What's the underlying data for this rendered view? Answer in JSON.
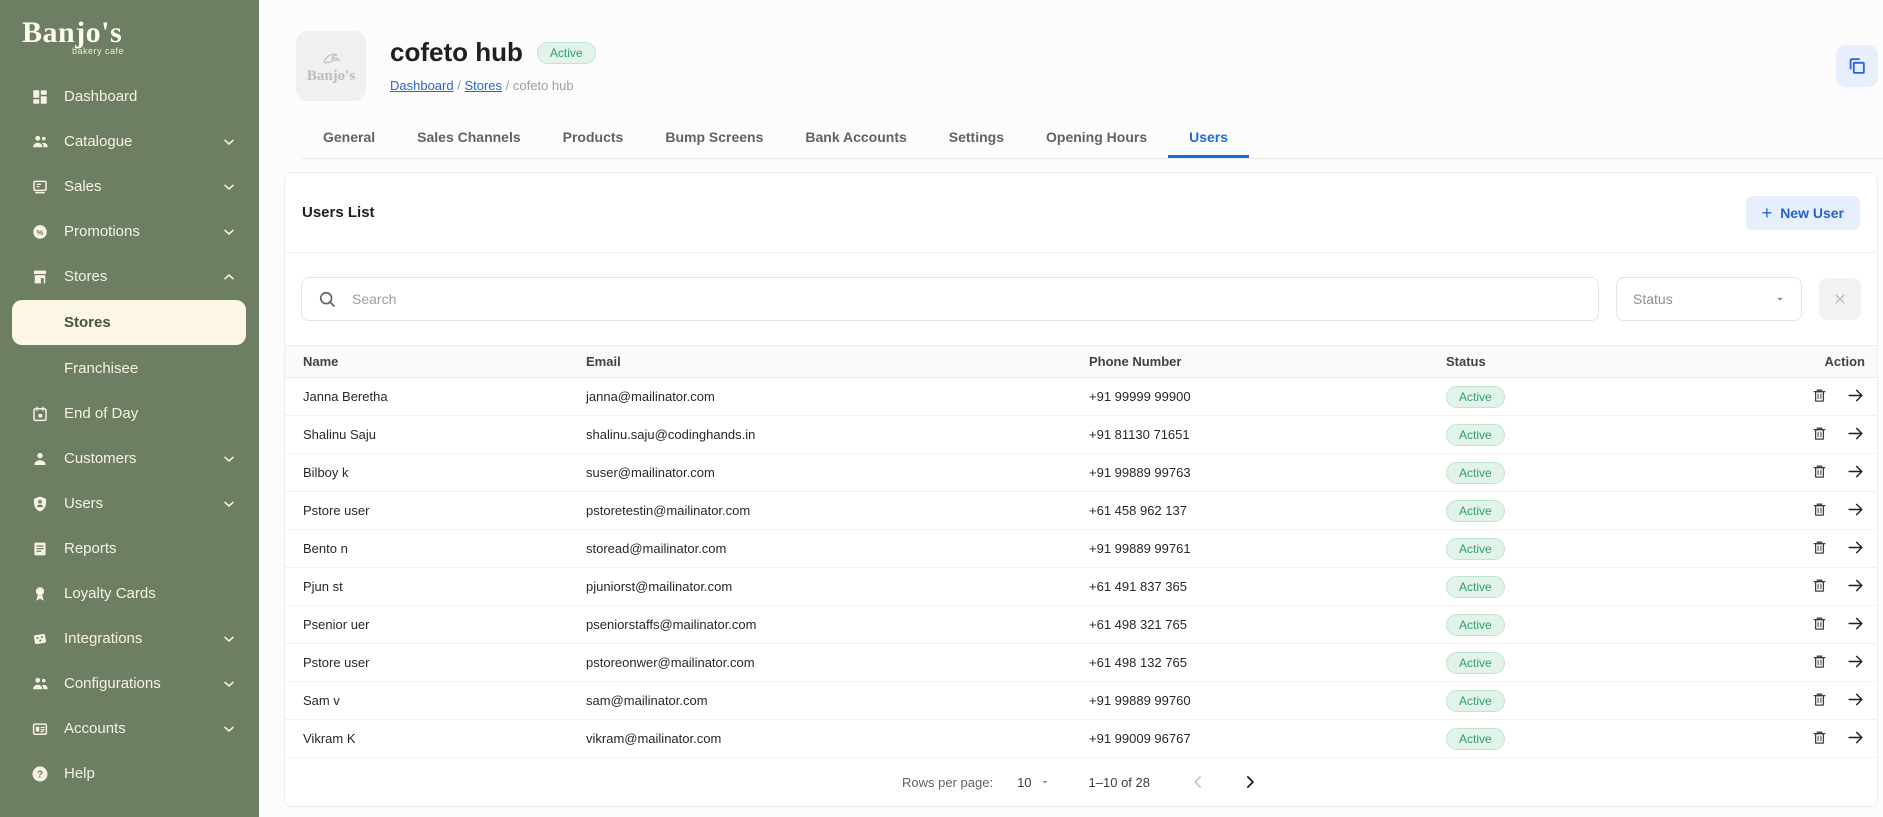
{
  "brand": {
    "name": "Banjo's",
    "tagline": "bakery cafe"
  },
  "colors": {
    "sidebar_green": "#6e7e63",
    "sidebar_active_cream": "#fcf7e5",
    "accent_blue": "#1a6fd4",
    "link_blue": "#2b66c4",
    "status_green_text": "#2f9e6b",
    "status_green_bg": "#e2f4ea"
  },
  "sidebar": {
    "items_top": [
      {
        "label": "Dashboard",
        "icon": "dashboard-icon"
      },
      {
        "label": "Catalogue",
        "icon": "catalogue-icon",
        "chevron": "down"
      },
      {
        "label": "Sales",
        "icon": "sales-icon",
        "chevron": "down"
      },
      {
        "label": "Promotions",
        "icon": "promotions-icon",
        "chevron": "down"
      },
      {
        "label": "Stores",
        "icon": "stores-icon",
        "chevron": "up",
        "expanded": true
      }
    ],
    "stores_submenu": [
      {
        "label": "Stores",
        "active": true
      },
      {
        "label": "Franchisee",
        "active": false
      }
    ],
    "items_bottom": [
      {
        "label": "End of Day",
        "icon": "calendar-icon"
      },
      {
        "label": "Customers",
        "icon": "customer-icon",
        "chevron": "down"
      },
      {
        "label": "Users",
        "icon": "users-shield-icon",
        "chevron": "down"
      },
      {
        "label": "Reports",
        "icon": "reports-icon"
      },
      {
        "label": "Loyalty Cards",
        "icon": "loyalty-icon"
      },
      {
        "label": "Integrations",
        "icon": "integrations-icon",
        "chevron": "down"
      },
      {
        "label": "Configurations",
        "icon": "configurations-icon",
        "chevron": "down"
      },
      {
        "label": "Accounts",
        "icon": "accounts-icon",
        "chevron": "down"
      },
      {
        "label": "Help",
        "icon": "help-icon"
      }
    ]
  },
  "header": {
    "store_name": "cofeto hub",
    "status_badge": "Active",
    "breadcrumb": {
      "dashboard": "Dashboard",
      "stores": "Stores",
      "separator": "/",
      "current": "cofeto hub"
    },
    "thumb_logo_text": "Banjo's",
    "copy_icon": "copy-icon"
  },
  "tabs": [
    "General",
    "Sales Channels",
    "Products",
    "Bump Screens",
    "Bank Accounts",
    "Settings",
    "Opening Hours",
    "Users"
  ],
  "active_tab": "Users",
  "users_list": {
    "title": "Users List",
    "new_user_button": "New User",
    "plus_sign": "+",
    "search_placeholder": "Search",
    "status_filter_label": "Status",
    "columns": {
      "name": "Name",
      "email": "Email",
      "phone": "Phone Number",
      "status": "Status",
      "action": "Action"
    },
    "rows": [
      {
        "name": "Janna Beretha",
        "email": "janna@mailinator.com",
        "phone": "+91 99999 99900",
        "status": "Active"
      },
      {
        "name": "Shalinu Saju",
        "email": "shalinu.saju@codinghands.in",
        "phone": "+91 81130 71651",
        "status": "Active"
      },
      {
        "name": "Bilboy k",
        "email": "suser@mailinator.com",
        "phone": "+91 99889 99763",
        "status": "Active"
      },
      {
        "name": "Pstore user",
        "email": "pstoretestin@mailinator.com",
        "phone": "+61 458 962 137",
        "status": "Active"
      },
      {
        "name": "Bento n",
        "email": "storead@mailinator.com",
        "phone": "+91 99889 99761",
        "status": "Active"
      },
      {
        "name": "Pjun st",
        "email": "pjuniorst@mailinator.com",
        "phone": "+61 491 837 365",
        "status": "Active"
      },
      {
        "name": "Psenior uer",
        "email": "pseniorstaffs@mailinator.com",
        "phone": "+61 498 321 765",
        "status": "Active"
      },
      {
        "name": "Pstore user",
        "email": "pstoreonwer@mailinator.com",
        "phone": "+61 498 132 765",
        "status": "Active"
      },
      {
        "name": "Sam v",
        "email": "sam@mailinator.com",
        "phone": "+91 99889 99760",
        "status": "Active"
      },
      {
        "name": "Vikram K",
        "email": "vikram@mailinator.com",
        "phone": "+91 99009 96767",
        "status": "Active"
      }
    ],
    "pagination": {
      "rows_per_page_label": "Rows per page:",
      "rows_per_page_value": "10",
      "range_label": "1–10 of 28"
    }
  }
}
